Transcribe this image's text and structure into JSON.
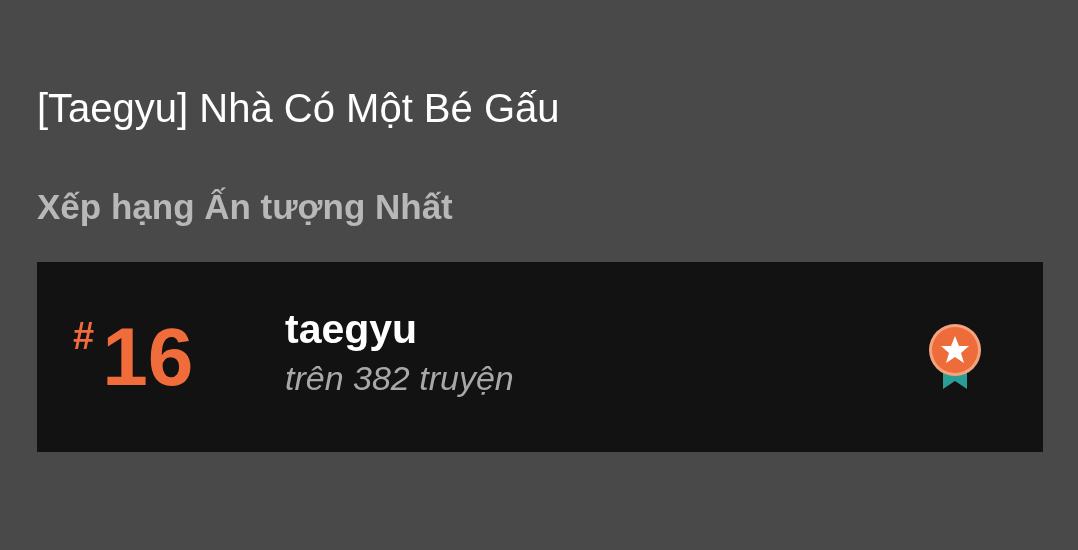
{
  "title": "[Taegyu] Nhà Có Một Bé Gấu",
  "section": {
    "heading": "Xếp hạng Ấn tượng Nhất",
    "ranking": {
      "hash": "#",
      "rank": "16",
      "tag": "taegyu",
      "subtitle": "trên 382 truyện"
    }
  }
}
